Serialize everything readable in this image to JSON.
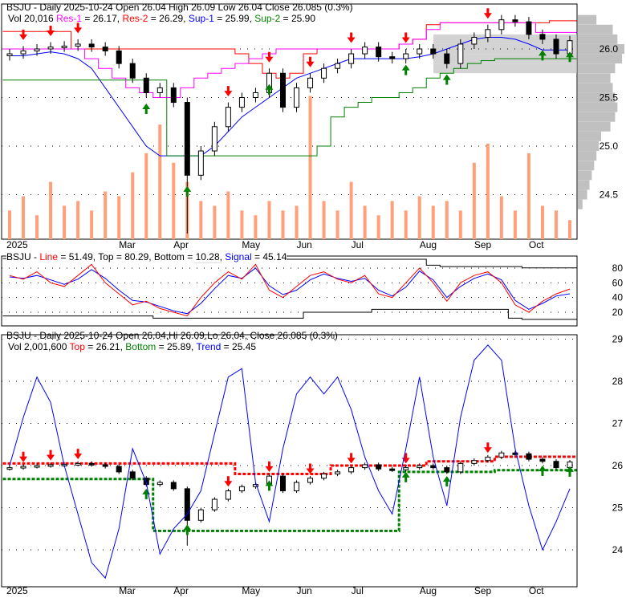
{
  "colors": {
    "candle": "#000000",
    "volume": "#ffa07a",
    "res1": "#ff00ff",
    "res2": "#ff0000",
    "sup1": "#0000ff",
    "sup2": "#008000",
    "profile": "#c0c0c0",
    "line": "#ff0000",
    "signal": "#0000ff",
    "trend": "#0000ff"
  },
  "panel1": {
    "line1": {
      "title": "BSJU - Daily 2025-10-24 Open 26.04  High 26.09  Low 26.04  Close 26.085 (0.3%)"
    },
    "line2": {
      "vol": "Vol 20,016 ",
      "res1_label": "Res-1",
      "res1_val": " = 26.17, ",
      "res2_label": "Res-2",
      "res2_val": " = 26.29, ",
      "sup1_label": "Sup-1",
      "sup1_val": " = 25.99, ",
      "sup2_label": "Sup-2",
      "sup2_val": " = 25.90"
    }
  },
  "panel2": {
    "prefix": "BSJU - ",
    "line_label": "Line",
    "line_val": " = 51.49, Top = 80.29, Bottom = 10.28, ",
    "signal_label": "Signal",
    "signal_val": " = 45.14"
  },
  "panel3": {
    "line1": "BSJU - Daily 2025-10-24 Open 26.04,Hi 26.09,Lo 26.04, Close 26.085 (0.3%)",
    "vol": "Vol 2,001,600 ",
    "top_label": "Top",
    "top_val": " = 26.21, ",
    "bottom_label": "Bottom",
    "bottom_val": " = 25.89, ",
    "trend_label": "Trend",
    "trend_val": " = 25.45"
  },
  "chart_data": {
    "type": "candlestick",
    "title": "BSJU - Daily",
    "x_tick_labels": [
      "2025",
      "Mar",
      "Apr",
      "May",
      "Jun",
      "Jul",
      "Aug",
      "Sep",
      "Oct"
    ],
    "x_tick_index": [
      0,
      8,
      12,
      17,
      21,
      25,
      30,
      34,
      38
    ],
    "price_ticks": [
      "26.0",
      "25.5",
      "25.0",
      "24.5"
    ],
    "price_tick_values": [
      26.0,
      25.5,
      25.0,
      24.5
    ],
    "osc_ticks": [
      "80",
      "60",
      "40",
      "20"
    ],
    "osc_tick_values": [
      80,
      60,
      40,
      20
    ],
    "price2_ticks": [
      "29",
      "28",
      "27",
      "26",
      "25",
      "24"
    ],
    "price2_tick_values": [
      29,
      28,
      27,
      26,
      25,
      24
    ],
    "close": [
      25.95,
      25.98,
      26.0,
      26.02,
      26.03,
      26.05,
      26.02,
      25.98,
      25.85,
      25.7,
      25.55,
      25.6,
      25.45,
      24.7,
      24.95,
      25.2,
      25.4,
      25.5,
      25.55,
      25.75,
      25.4,
      25.6,
      25.7,
      25.8,
      25.85,
      25.95,
      26.02,
      25.92,
      25.9,
      25.95,
      26.0,
      25.95,
      25.85,
      26.05,
      26.12,
      26.2,
      26.3,
      26.28,
      26.15,
      26.1,
      25.95,
      26.085
    ],
    "volume_k": [
      30,
      45,
      25,
      60,
      35,
      40,
      30,
      50,
      45,
      70,
      90,
      120,
      80,
      60,
      40,
      35,
      50,
      30,
      25,
      40,
      30,
      35,
      150,
      40,
      30,
      60,
      35,
      25,
      40,
      30,
      45,
      35,
      40,
      30,
      80,
      100,
      45,
      30,
      90,
      35,
      30,
      20
    ],
    "res1": [
      26.0,
      26.0,
      26.0,
      26.0,
      26.0,
      26.0,
      25.9,
      25.8,
      25.7,
      25.6,
      25.55,
      25.5,
      25.5,
      25.6,
      25.7,
      25.75,
      25.8,
      25.85,
      25.9,
      25.95,
      26.0,
      26.0,
      26.0,
      26.0,
      26.0,
      26.0,
      26.0,
      26.0,
      26.0,
      26.05,
      26.1,
      26.2,
      26.27,
      26.27,
      26.27,
      26.27,
      26.27,
      26.27,
      26.27,
      26.17,
      26.17,
      26.17
    ],
    "res2": [
      26.18,
      26.18,
      26.18,
      26.18,
      26.18,
      26.0,
      26.0,
      26.0,
      26.0,
      26.0,
      26.0,
      26.0,
      26.0,
      26.0,
      26.0,
      26.0,
      26.0,
      25.95,
      25.85,
      25.75,
      25.7,
      25.75,
      25.95,
      26.0,
      26.0,
      26.0,
      26.0,
      26.0,
      26.0,
      26.05,
      26.1,
      26.25,
      26.27,
      26.27,
      26.27,
      26.27,
      26.27,
      26.27,
      26.27,
      26.27,
      26.29,
      26.29
    ],
    "sup1": [
      25.93,
      25.93,
      25.95,
      25.97,
      25.95,
      25.9,
      25.8,
      25.6,
      25.4,
      25.2,
      25.0,
      24.9,
      24.9,
      24.9,
      24.9,
      25.0,
      25.15,
      25.3,
      25.4,
      25.5,
      25.6,
      25.7,
      25.75,
      25.8,
      25.85,
      25.9,
      25.9,
      25.9,
      25.9,
      25.9,
      25.92,
      25.95,
      26.0,
      26.05,
      26.1,
      26.12,
      26.12,
      26.1,
      26.05,
      25.99,
      25.99,
      25.99
    ],
    "sup2": [
      25.68,
      25.68,
      25.68,
      25.68,
      25.68,
      25.68,
      25.68,
      25.68,
      25.68,
      25.68,
      25.68,
      25.68,
      24.9,
      24.9,
      24.9,
      24.9,
      24.9,
      24.9,
      24.9,
      24.9,
      24.9,
      24.9,
      24.9,
      25.0,
      25.3,
      25.4,
      25.45,
      25.5,
      25.5,
      25.55,
      25.6,
      25.7,
      25.75,
      25.8,
      25.85,
      25.88,
      25.9,
      25.9,
      25.9,
      25.9,
      25.9,
      25.9
    ],
    "sell_signals": [
      1,
      3,
      5,
      16,
      19,
      22,
      25,
      29,
      35
    ],
    "buy_signals": [
      10,
      13,
      19,
      29,
      32,
      39,
      41
    ],
    "volume_profile": {
      "prices": [
        24.4,
        24.5,
        24.6,
        24.7,
        24.8,
        24.9,
        25.0,
        25.1,
        25.2,
        25.3,
        25.4,
        25.5,
        25.6,
        25.7,
        25.8,
        25.9,
        26.0,
        26.1,
        26.2,
        26.3
      ],
      "relative": [
        0.1,
        0.2,
        0.25,
        0.3,
        0.35,
        0.4,
        0.45,
        0.5,
        0.7,
        0.8,
        0.85,
        0.8,
        0.75,
        0.7,
        0.8,
        0.95,
        1.0,
        0.85,
        0.75,
        0.4
      ]
    },
    "osc_line": [
      70,
      65,
      75,
      60,
      55,
      70,
      85,
      60,
      45,
      30,
      35,
      25,
      20,
      15,
      40,
      60,
      75,
      65,
      85,
      50,
      40,
      55,
      70,
      75,
      65,
      60,
      70,
      45,
      40,
      60,
      80,
      60,
      35,
      60,
      70,
      75,
      60,
      30,
      20,
      35,
      45,
      51.49
    ],
    "osc_signal": [
      68,
      66,
      70,
      64,
      58,
      65,
      78,
      66,
      50,
      36,
      34,
      28,
      22,
      18,
      32,
      52,
      70,
      66,
      80,
      56,
      44,
      50,
      64,
      72,
      66,
      62,
      66,
      50,
      42,
      54,
      76,
      64,
      40,
      55,
      66,
      72,
      64,
      36,
      24,
      32,
      42,
      45.14
    ],
    "osc_top": [
      93,
      93,
      93,
      93,
      93,
      93,
      93,
      93,
      93,
      93,
      93,
      93,
      93,
      93,
      88,
      88,
      92,
      92,
      92,
      92,
      92,
      92,
      92,
      92,
      92,
      92,
      92,
      92,
      92,
      92,
      92,
      84,
      82,
      82,
      82,
      82,
      82,
      82,
      80.29,
      80.29,
      80.29,
      80.29
    ],
    "osc_bottom": [
      15,
      15,
      15,
      15,
      15,
      15,
      15,
      15,
      15,
      15,
      15,
      12,
      12,
      12,
      12,
      12,
      12,
      12,
      12,
      12,
      12,
      12,
      20,
      20,
      20,
      20,
      20,
      24,
      24,
      24,
      24,
      24,
      24,
      24,
      24,
      24,
      24,
      12,
      10.28,
      10.28,
      10.28,
      10.28
    ],
    "trend": [
      26.0,
      27.14,
      28.1,
      27.5,
      26.0,
      24.85,
      23.7,
      23.33,
      24.5,
      26.4,
      25.6,
      23.9,
      24.5,
      24.85,
      25.4,
      26.76,
      28.1,
      28.3,
      25.6,
      24.67,
      26.4,
      27.7,
      28.1,
      27.7,
      28.1,
      27.33,
      26.2,
      25.4,
      24.85,
      26.4,
      28.1,
      26.2,
      25.05,
      27.14,
      28.5,
      28.86,
      28.5,
      26.4,
      25.05,
      24.0,
      24.67,
      25.45
    ],
    "top_band": [
      26.05,
      26.05,
      26.05,
      26.05,
      26.05,
      26.05,
      26.05,
      26.05,
      26.05,
      26.05,
      26.05,
      26.05,
      26.05,
      26.05,
      26.05,
      26.05,
      26.05,
      25.8,
      25.8,
      25.8,
      25.8,
      25.8,
      25.8,
      25.8,
      26.0,
      26.0,
      26.0,
      26.0,
      26.0,
      26.0,
      26.0,
      26.1,
      26.1,
      26.1,
      26.1,
      26.1,
      26.21,
      26.21,
      26.21,
      26.21,
      26.21,
      26.21
    ],
    "bottom_band": [
      25.68,
      25.68,
      25.68,
      25.68,
      25.68,
      25.68,
      25.68,
      25.68,
      25.68,
      25.68,
      25.68,
      24.45,
      24.45,
      24.45,
      24.45,
      24.45,
      24.45,
      24.45,
      24.45,
      24.45,
      24.45,
      24.45,
      24.45,
      24.45,
      24.45,
      24.45,
      24.45,
      24.45,
      24.45,
      25.85,
      25.85,
      25.85,
      25.85,
      25.85,
      25.85,
      25.85,
      25.89,
      25.89,
      25.89,
      25.89,
      25.89,
      25.89
    ]
  }
}
